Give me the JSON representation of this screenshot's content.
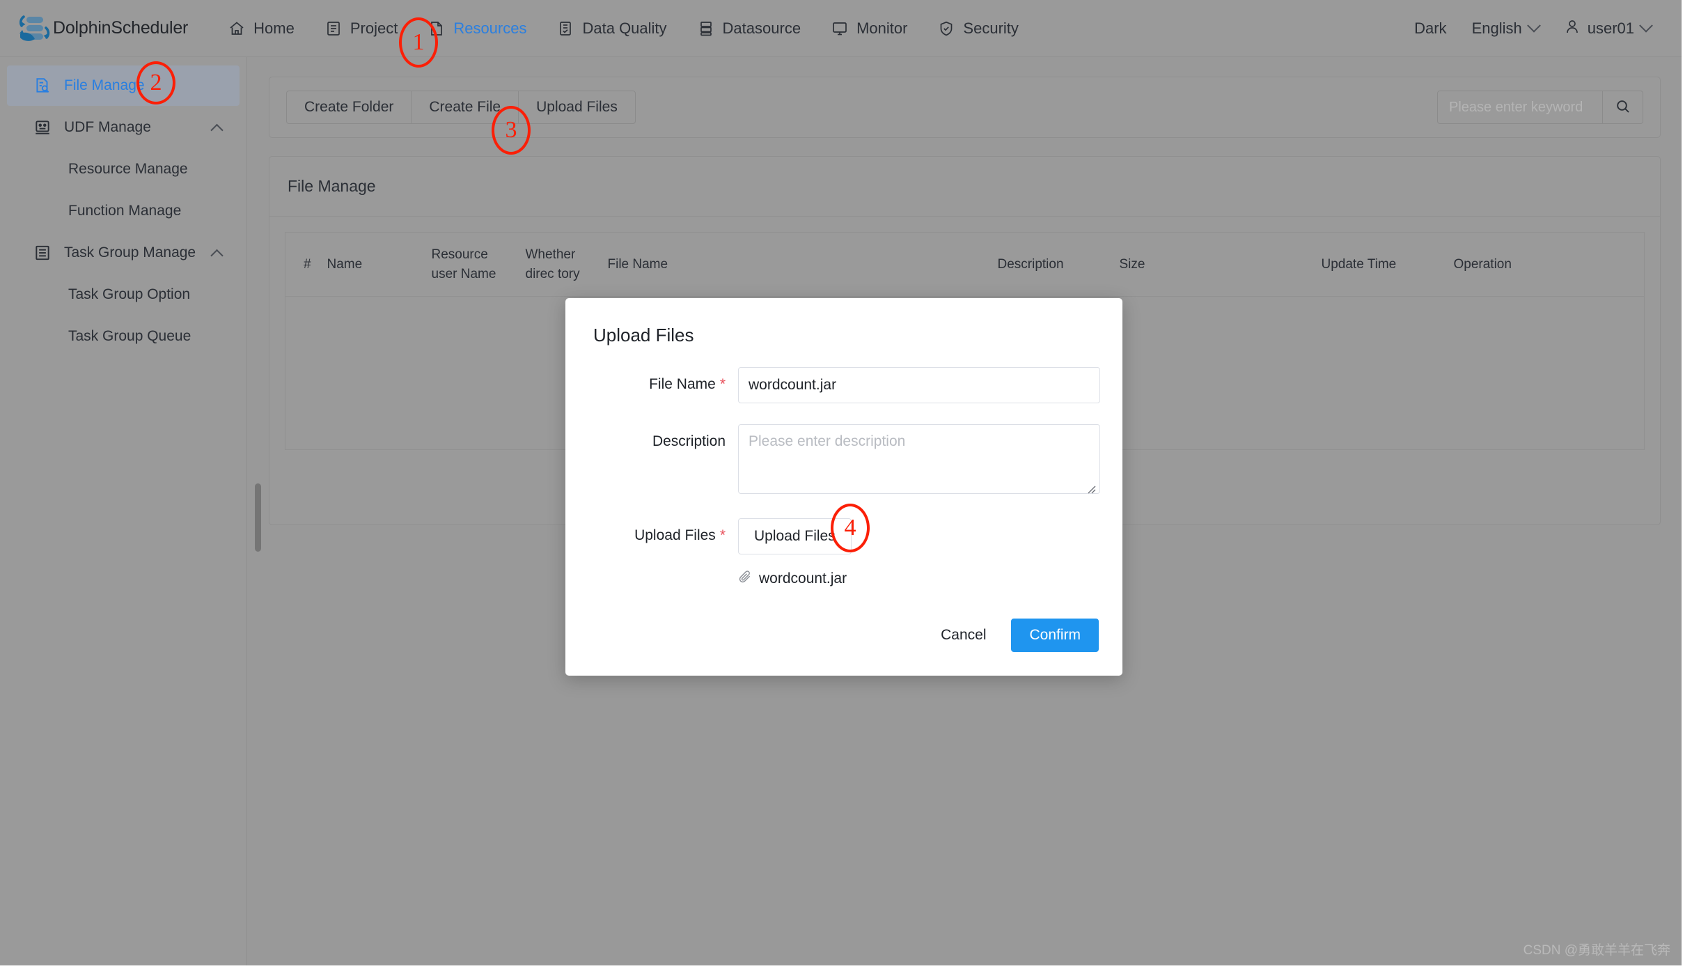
{
  "header": {
    "brand": "DolphinScheduler",
    "nav": [
      {
        "label": "Home",
        "icon": "home-icon",
        "active": false
      },
      {
        "label": "Project",
        "icon": "project-icon",
        "active": false
      },
      {
        "label": "Resources",
        "icon": "resources-icon",
        "active": true
      },
      {
        "label": "Data Quality",
        "icon": "data-quality-icon",
        "active": false
      },
      {
        "label": "Datasource",
        "icon": "datasource-icon",
        "active": false
      },
      {
        "label": "Monitor",
        "icon": "monitor-icon",
        "active": false
      },
      {
        "label": "Security",
        "icon": "security-icon",
        "active": false
      }
    ],
    "theme_label": "Dark",
    "language_label": "English",
    "user_label": "user01"
  },
  "sidebar": {
    "items": [
      {
        "label": "File Manage",
        "icon": "file-manage-icon",
        "active": true,
        "caret": false,
        "sub": false
      },
      {
        "label": "UDF Manage",
        "icon": "udf-manage-icon",
        "active": false,
        "caret": true,
        "sub": false
      },
      {
        "label": "Resource Manage",
        "icon": "",
        "active": false,
        "caret": false,
        "sub": true
      },
      {
        "label": "Function Manage",
        "icon": "",
        "active": false,
        "caret": false,
        "sub": true
      },
      {
        "label": "Task Group Manage",
        "icon": "task-group-icon",
        "active": false,
        "caret": true,
        "sub": false
      },
      {
        "label": "Task Group Option",
        "icon": "",
        "active": false,
        "caret": false,
        "sub": true
      },
      {
        "label": "Task Group Queue",
        "icon": "",
        "active": false,
        "caret": false,
        "sub": true
      }
    ]
  },
  "toolbar": {
    "create_folder_label": "Create Folder",
    "create_file_label": "Create File",
    "upload_files_label": "Upload Files",
    "search_placeholder": "Please enter keyword",
    "search_value": "",
    "search_icon": "search-icon"
  },
  "table": {
    "title": "File Manage",
    "columns": [
      "#",
      "Name",
      "Resource user Name",
      "Whether direc tory",
      "File Name",
      "Description",
      "Size",
      "Update Time",
      "Operation"
    ],
    "rows": []
  },
  "modal": {
    "title": "Upload Files",
    "file_name_label": "File Name",
    "file_name_value": "wordcount.jar",
    "description_label": "Description",
    "description_value": "",
    "description_placeholder": "Please enter description",
    "upload_label": "Upload Files",
    "upload_button_label": "Upload Files",
    "attached_file": "wordcount.jar",
    "attachment_icon": "paperclip-icon",
    "required_mark": "*",
    "cancel_label": "Cancel",
    "confirm_label": "Confirm",
    "confirm_color": "#1f95ef"
  },
  "annotations": [
    {
      "number": "1"
    },
    {
      "number": "2"
    },
    {
      "number": "3"
    },
    {
      "number": "4"
    }
  ],
  "watermark": "CSDN @勇敢羊羊在飞奔"
}
